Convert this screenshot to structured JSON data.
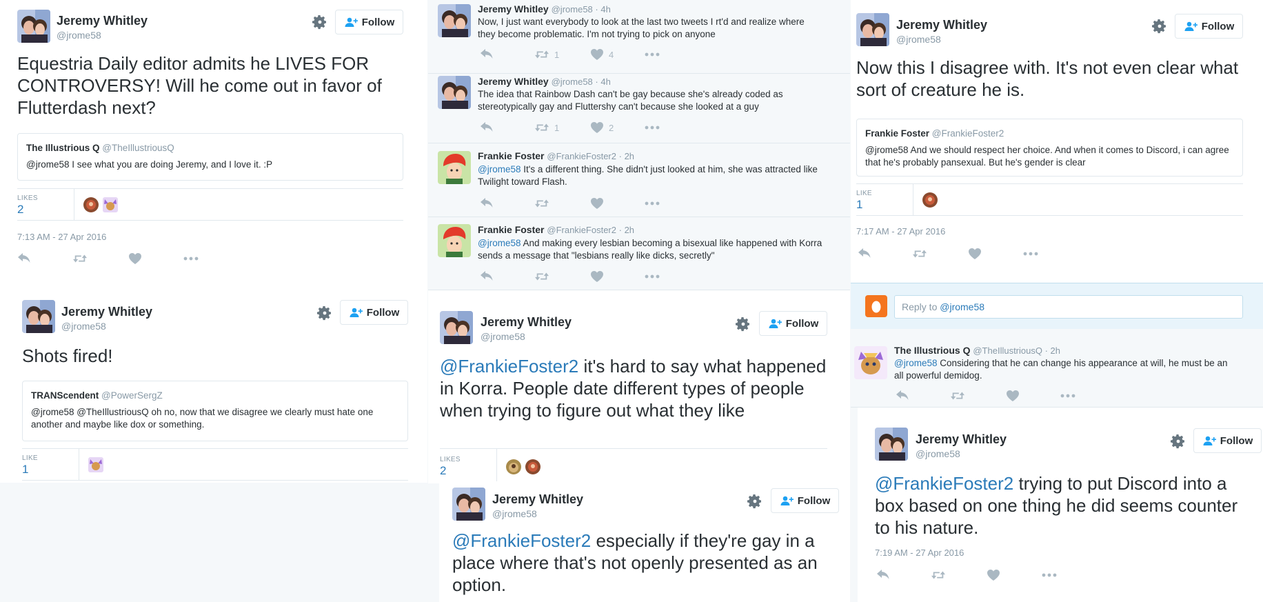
{
  "user": {
    "name": "Jeremy Whitley",
    "handle": "@jrome58"
  },
  "follow_label": "Follow",
  "tweet1": {
    "text": "Equestria Daily editor admits he LIVES FOR CONTROVERSY! Will he come out in favor of Flutterdash next?",
    "quote": {
      "name": "The Illustrious Q",
      "handle": "@TheIllustriousQ",
      "text": "@jrome58 I see what you are doing Jeremy, and I love it. :P"
    },
    "likes_label": "LIKES",
    "likes": "2",
    "time": "7:13 AM - 27 Apr 2016"
  },
  "tweet2": {
    "text": "Shots fired!",
    "quote": {
      "name": "TRANScendent",
      "handle": "@PowerSergZ",
      "text": "@jrome58 @TheIllustriousQ oh no, now that we disagree we clearly must hate one another and maybe like dox or something."
    },
    "likes_label": "LIKE",
    "likes": "1"
  },
  "thread": [
    {
      "name": "Jeremy Whitley",
      "handle": "@jrome58",
      "age": "4h",
      "text": "Now, I just want everybody to look at the last two tweets I rt'd and realize where they become problematic. I'm not trying to pick on anyone",
      "retweets": "1",
      "likes": "4"
    },
    {
      "name": "Jeremy Whitley",
      "handle": "@jrome58",
      "age": "4h",
      "text": "The idea that Rainbow Dash can't be gay because she's already coded as stereotypically gay and Fluttershy can't because she looked at a guy",
      "retweets": "1",
      "likes": "2"
    },
    {
      "name": "Frankie Foster",
      "handle": "@FrankieFoster2",
      "age": "2h",
      "mention": "@jrome58",
      "text": " It's a different thing. She didn't just looked at him, she was attracted like Twilight toward Flash.",
      "retweets": "",
      "likes": ""
    },
    {
      "name": "Frankie Foster",
      "handle": "@FrankieFoster2",
      "age": "2h",
      "mention": "@jrome58",
      "text": " And making every lesbian becoming a bisexual like happened with Korra sends a message that \"lesbians really like dicks, secretly\"",
      "retweets": "",
      "likes": ""
    }
  ],
  "tweet3": {
    "mention": "@FrankieFoster2",
    "text": " it's hard to say what happened in Korra. People date different types of people when trying to figure out what they like",
    "likes_label": "LIKES",
    "likes": "2"
  },
  "tweet4": {
    "mention": "@FrankieFoster2",
    "text": " especially if they're gay in a place where that's not openly presented as an option."
  },
  "tweet5": {
    "text": "Now this I disagree with.  It's not even clear what sort of creature he is.",
    "quote": {
      "name": "Frankie Foster",
      "handle": "@FrankieFoster2",
      "text": "@jrome58 And we should respect her choice. And when it comes to Discord, i can agree that he's probably pansexual. But he's gender is clear"
    },
    "likes_label": "LIKE",
    "likes": "1",
    "time": "7:17 AM - 27 Apr 2016"
  },
  "reply_box": {
    "prefix": "Reply to ",
    "mention": "@jrome58"
  },
  "reply": {
    "name": "The Illustrious Q",
    "handle": "@TheIllustriousQ",
    "age": "2h",
    "mention": "@jrome58",
    "text": " Considering that he can change his appearance at will, he must be an all powerful demidog."
  },
  "tweet6": {
    "mention": "@FrankieFoster2",
    "text": " trying to put Discord into a box based on one thing he did seems counter to his nature.",
    "time": "7:19 AM - 27 Apr 2016"
  },
  "icons": [
    "gear-icon",
    "follow-person-icon",
    "reply-icon",
    "retweet-icon",
    "heart-icon",
    "more-icon",
    "egg-avatar-icon"
  ],
  "colors": {
    "link": "#2b7bb9",
    "muted": "#8899a6",
    "action": "#aab8c2",
    "border": "#e1e8ed",
    "gray_bg": "#f5f8fa",
    "egg": "#f4751e"
  }
}
